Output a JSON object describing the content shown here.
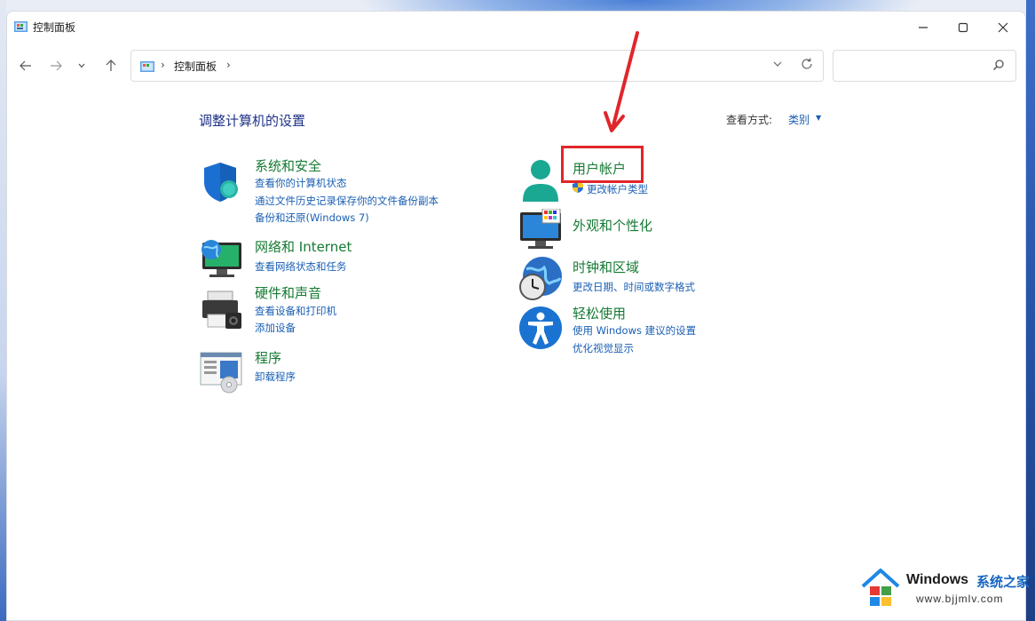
{
  "window": {
    "title": "控制面板"
  },
  "address_bar": {
    "path": "控制面板"
  },
  "search": {
    "placeholder": ""
  },
  "content": {
    "heading": "调整计算机的设置",
    "view_by_label": "查看方式:",
    "view_by_value": "类别"
  },
  "categories": [
    {
      "title": "系统和安全",
      "links": [
        "查看你的计算机状态",
        "通过文件历史记录保存你的文件备份副本",
        "备份和还原(Windows 7)"
      ]
    },
    {
      "title": "网络和 Internet",
      "links": [
        "查看网络状态和任务"
      ]
    },
    {
      "title": "硬件和声音",
      "links": [
        "查看设备和打印机",
        "添加设备"
      ]
    },
    {
      "title": "程序",
      "links": [
        "卸载程序"
      ]
    },
    {
      "title": "用户帐户",
      "links": [
        "更改帐户类型"
      ]
    },
    {
      "title": "外观和个性化",
      "links": []
    },
    {
      "title": "时钟和区域",
      "links": [
        "更改日期、时间或数字格式"
      ]
    },
    {
      "title": "轻松使用",
      "links": [
        "使用 Windows 建议的设置",
        "优化视觉显示"
      ]
    }
  ],
  "watermark": {
    "brand": "Windows",
    "brand_cn": "系统之家",
    "url": "www.bjjmlv.com"
  },
  "colors": {
    "category_title": "#157a33",
    "link": "#1a5fb4",
    "heading": "#1e3287",
    "annotation": "#e0262b"
  }
}
